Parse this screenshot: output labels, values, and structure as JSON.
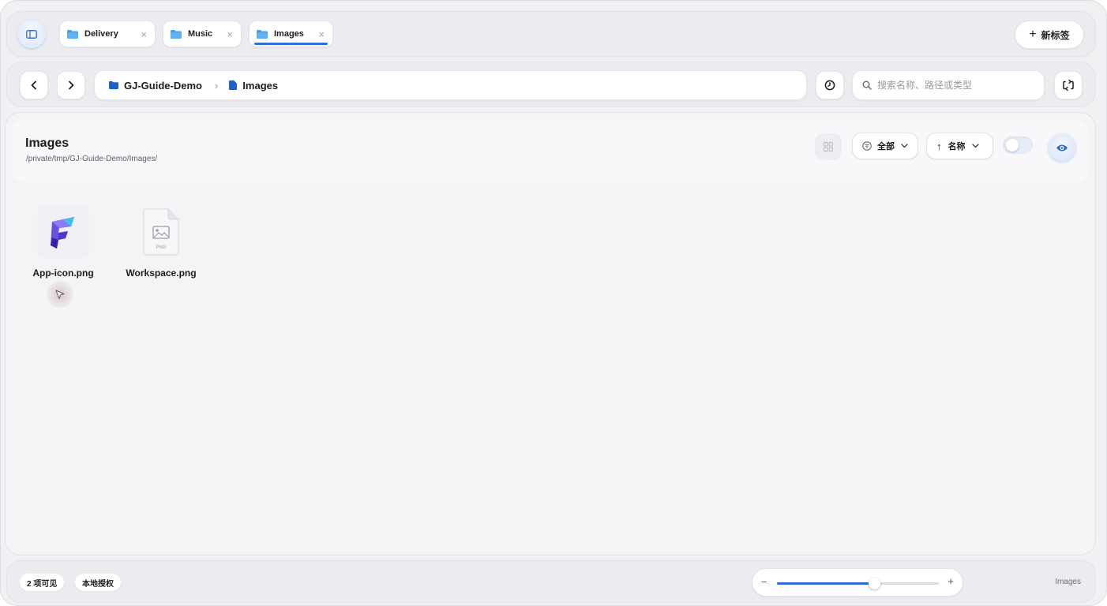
{
  "tabs": [
    {
      "label": "Delivery",
      "close": "×",
      "active": false
    },
    {
      "label": "Music",
      "close": "×",
      "active": false
    },
    {
      "label": "Images",
      "close": "×",
      "active": true
    }
  ],
  "new_tab": {
    "plus": "+",
    "label": "新标签"
  },
  "nav": {
    "back_icon": "chevron-left-icon",
    "forward_icon": "chevron-right-icon"
  },
  "breadcrumb": [
    {
      "label": "GJ-Guide-Demo",
      "icon": "folder-icon"
    },
    {
      "label": "Images",
      "icon": "document-icon"
    }
  ],
  "search": {
    "placeholder": "搜索名称、路径或类型"
  },
  "header": {
    "title": "Images",
    "path": "/private/tmp/GJ-Guide-Demo/Images/"
  },
  "filter": {
    "label": "全部"
  },
  "sort": {
    "arrow": "↑",
    "label": "名称"
  },
  "files": [
    {
      "name": "App-icon.png",
      "type": "app-icon"
    },
    {
      "name": "Workspace.png",
      "type": "png",
      "badge": "PNG"
    }
  ],
  "status": {
    "count": "2 项可见",
    "license": "本地授权",
    "location": "Images"
  },
  "zoom": {
    "minus": "−",
    "plus": "+",
    "level": 0.6
  },
  "colors": {
    "accent": "#2f6fd8",
    "folder": "#4a9fe0",
    "background": "#f1f1f4"
  }
}
